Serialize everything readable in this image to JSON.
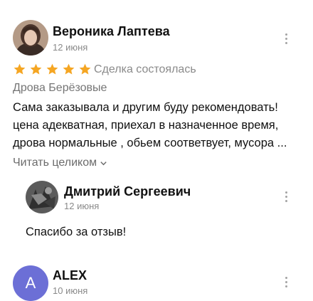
{
  "review": {
    "author": "Вероника Лаптева",
    "date": "12 июня",
    "rating": 5,
    "deal_status": "Сделка состоялась",
    "product": "Дрова Берёзовые",
    "text_lines": [
      "Сама заказывала и другим буду рекомендовать!",
      "цена адекватная, приехал в назначенное время,",
      "дрова нормальные , обьем соответвует, мусора ..."
    ],
    "read_more": "Читать целиком",
    "star_color": "#f5a623"
  },
  "reply": {
    "author": "Дмитрий Сергеевич",
    "date": "12 июня",
    "text": "Спасибо за отзыв!"
  },
  "next_review": {
    "author": "ALEX",
    "date": "10 июня",
    "avatar_letter": "A",
    "avatar_color": "#6c6fd6"
  }
}
